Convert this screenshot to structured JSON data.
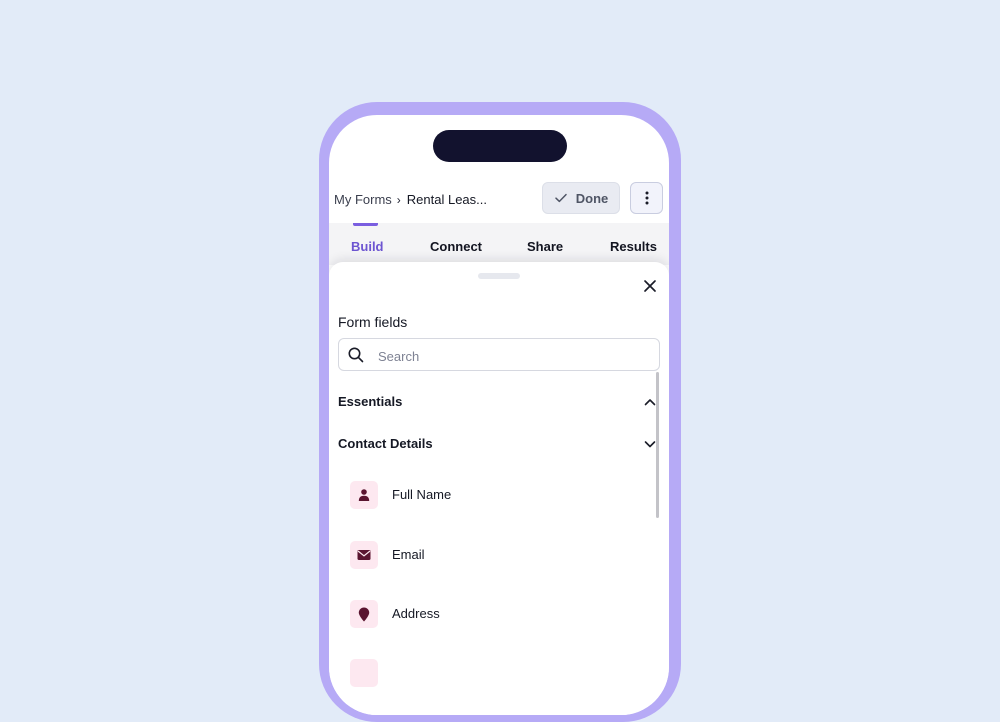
{
  "breadcrumb": {
    "parent": "My Forms",
    "separator": "›",
    "current": "Rental Leas..."
  },
  "toolbar": {
    "done_label": "Done"
  },
  "tabs": [
    {
      "label": "Build",
      "active": true
    },
    {
      "label": "Connect",
      "active": false
    },
    {
      "label": "Share",
      "active": false
    },
    {
      "label": "Results",
      "active": false
    }
  ],
  "sheet": {
    "title": "Form fields",
    "search_placeholder": "Search",
    "search_value": "",
    "sections": [
      {
        "label": "Essentials",
        "expanded": true
      },
      {
        "label": "Contact Details",
        "expanded": false
      }
    ],
    "fields": [
      {
        "label": "Full Name",
        "icon": "person-icon"
      },
      {
        "label": "Email",
        "icon": "envelope-icon"
      },
      {
        "label": "Address",
        "icon": "map-pin-icon"
      }
    ]
  },
  "colors": {
    "background": "#e2ebf8",
    "phone_frame": "#b6aaf6",
    "accent": "#6d55d1",
    "icon_tile": "#fde8f0",
    "icon_glyph": "#5a1530"
  }
}
